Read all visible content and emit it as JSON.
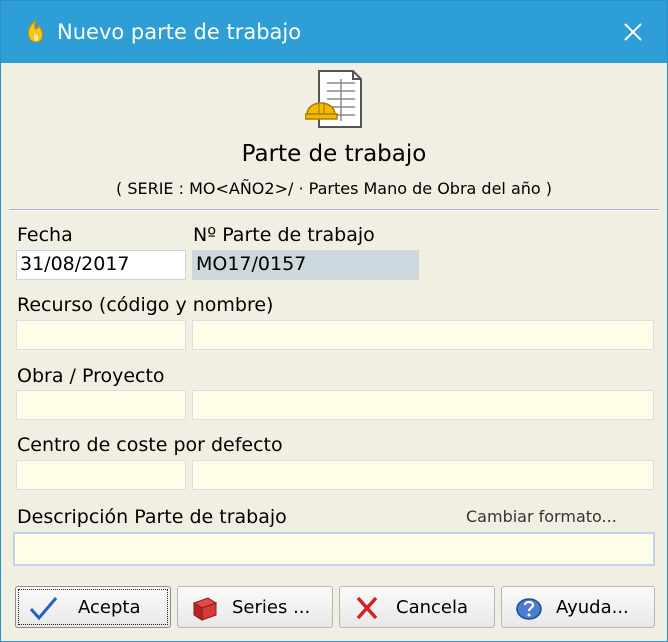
{
  "window": {
    "title": "Nuevo parte de trabajo"
  },
  "header": {
    "title": "Parte de trabajo",
    "subtitle": "( SERIE : MO<AÑO2>/ · Partes Mano de Obra del año )"
  },
  "form": {
    "fecha": {
      "label": "Fecha",
      "value": "31/08/2017"
    },
    "numero": {
      "label": "Nº Parte de trabajo",
      "value": "MO17/0157"
    },
    "recurso": {
      "label": "Recurso (código y nombre)",
      "code": "",
      "name": ""
    },
    "obra": {
      "label": "Obra / Proyecto",
      "code": "",
      "name": ""
    },
    "centro": {
      "label": "Centro de coste por defecto",
      "code": "",
      "name": ""
    },
    "descripcion": {
      "label": "Descripción Parte de trabajo",
      "value": "",
      "change_format": "Cambiar formato..."
    }
  },
  "buttons": {
    "accept": "Acepta",
    "series": "Series ...",
    "cancel": "Cancela",
    "help": "Ayuda..."
  },
  "colors": {
    "titlebar": "#2e9fd6",
    "dialog_bg": "#f1efe2",
    "input_bg": "#fdfde8",
    "readonly_bg": "#ccd8dc"
  }
}
